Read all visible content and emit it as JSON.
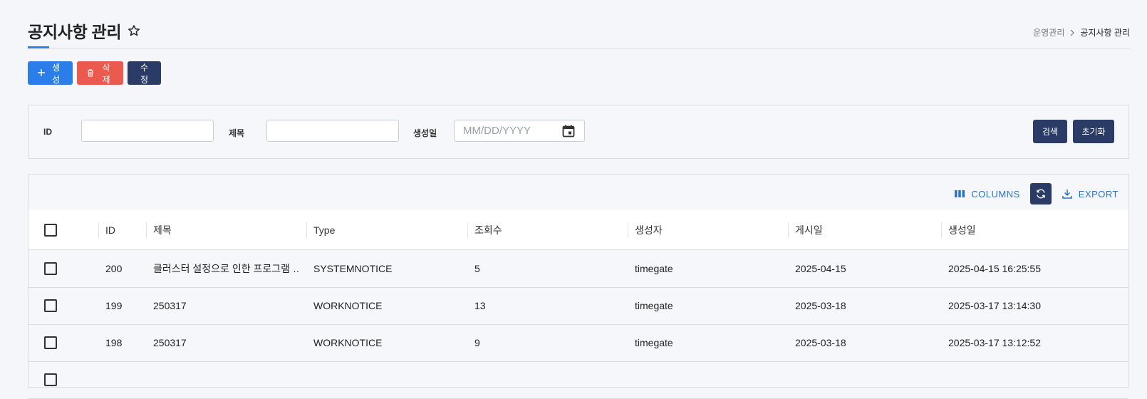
{
  "header": {
    "title": "공지사항 관리",
    "breadcrumb": {
      "parent": "운영관리",
      "current": "공지사항 관리"
    }
  },
  "actions": {
    "create_label": "생성",
    "delete_label": "삭제",
    "edit_label": "수정"
  },
  "filter": {
    "id_label": "ID",
    "title_label": "제목",
    "created_label": "생성일",
    "id_value": "",
    "title_value": "",
    "date_placeholder": "MM/DD/YYYY",
    "search_label": "검색",
    "reset_label": "초기화"
  },
  "toolbar": {
    "columns_label": "COLUMNS",
    "export_label": "EXPORT"
  },
  "table": {
    "headers": {
      "id": "ID",
      "title": "제목",
      "type": "Type",
      "views": "조회수",
      "creator": "생성자",
      "posted": "게시일",
      "created": "생성일"
    },
    "rows": [
      {
        "id": "200",
        "title": "클러스터 설정으로 인한 프로그램 …",
        "type": "SYSTEMNOTICE",
        "views": "5",
        "creator": "timegate",
        "posted": "2025-04-15",
        "created": "2025-04-15 16:25:55"
      },
      {
        "id": "199",
        "title": "250317",
        "type": "WORKNOTICE",
        "views": "13",
        "creator": "timegate",
        "posted": "2025-03-18",
        "created": "2025-03-17 13:14:30"
      },
      {
        "id": "198",
        "title": "250317",
        "type": "WORKNOTICE",
        "views": "9",
        "creator": "timegate",
        "posted": "2025-03-18",
        "created": "2025-03-17 13:12:52"
      }
    ]
  },
  "colors": {
    "primary": "#2b7de9",
    "danger": "#ea5a4e",
    "navy": "#2a3b66",
    "link": "#2b72c8"
  }
}
